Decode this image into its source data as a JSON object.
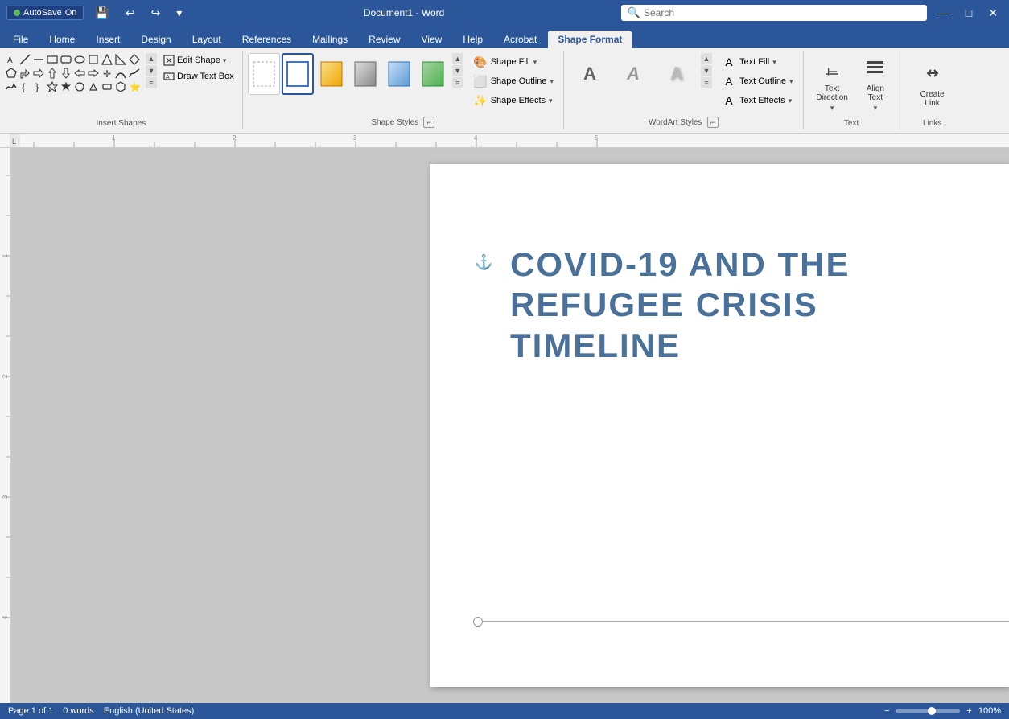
{
  "titlebar": {
    "autosave_label": "AutoSave",
    "autosave_on": "On",
    "save_icon": "💾",
    "undo_icon": "↩",
    "redo_icon": "↪",
    "customize_icon": "▾",
    "doc_title": "Document1 - Word",
    "search_placeholder": "Search",
    "search_icon": "🔍"
  },
  "ribbon_tabs": [
    {
      "label": "File",
      "active": false
    },
    {
      "label": "Home",
      "active": false
    },
    {
      "label": "Insert",
      "active": false
    },
    {
      "label": "Design",
      "active": false
    },
    {
      "label": "Layout",
      "active": false
    },
    {
      "label": "References",
      "active": false
    },
    {
      "label": "Mailings",
      "active": false
    },
    {
      "label": "Review",
      "active": false
    },
    {
      "label": "View",
      "active": false
    },
    {
      "label": "Help",
      "active": false
    },
    {
      "label": "Acrobat",
      "active": false
    },
    {
      "label": "Shape Format",
      "active": true
    }
  ],
  "groups": {
    "insert_shapes": {
      "label": "Insert Shapes",
      "edit_shape_label": "Edit Shape",
      "draw_text_box_label": "Draw Text Box"
    },
    "shape_styles": {
      "label": "Shape Styles",
      "swatches": [
        {
          "id": "none",
          "label": "No fill/border"
        },
        {
          "id": "blue-outline",
          "label": "Blue outline style",
          "selected": true
        },
        {
          "id": "s3",
          "label": "Style 3"
        },
        {
          "id": "s4",
          "label": "Style 4"
        },
        {
          "id": "s5",
          "label": "Style 5"
        },
        {
          "id": "s6",
          "label": "Style 6"
        }
      ],
      "fill_label": "Shape Fill",
      "outline_label": "Shape Outline",
      "effects_label": "Shape Effects",
      "format_shape_label": "Format Shape"
    },
    "wordart_styles": {
      "label": "WordArt Styles",
      "swatches": [
        {
          "id": "wa1",
          "char": "A",
          "style": "wordart-a1"
        },
        {
          "id": "wa2",
          "char": "A",
          "style": "wordart-a2"
        },
        {
          "id": "wa3",
          "char": "A",
          "style": "wordart-a3"
        }
      ],
      "text_fill_label": "Text Fill",
      "text_outline_label": "Text Outline",
      "text_effects_label": "Text Effects",
      "dialog_icon": "⌐"
    },
    "text": {
      "label": "Text",
      "text_direction_label": "Text\nDirection",
      "align_text_label": "Align\nText"
    },
    "links": {
      "label": "Links",
      "create_link_label": "Create\nLink"
    }
  },
  "document": {
    "title_line1": "COVID-19 AND THE",
    "title_line2": "REFUGEE CRISIS TIMELINE"
  },
  "statusbar": {
    "page_info": "Page 1 of 1",
    "word_count": "0 words",
    "language": "English (United States)",
    "zoom": "100%"
  },
  "style_swatches": [
    {
      "line_color": "transparent",
      "line_style": "dashed",
      "bg": "transparent"
    },
    {
      "line_color": "#5b9bd5",
      "bg": "#dce6f0"
    },
    {
      "line_color": "#f0a500",
      "bg": "transparent",
      "gradient": "linear-gradient(135deg, #f9e08b, #f0a500)"
    },
    {
      "line_color": "#888",
      "bg": "transparent",
      "gradient": "linear-gradient(135deg, #ccc, #888)"
    },
    {
      "line_color": "#5b9bd5",
      "bg": "transparent",
      "gradient": "linear-gradient(135deg, #c7ddf7, #5b9bd5)"
    },
    {
      "line_color": "#4caf50",
      "bg": "transparent",
      "gradient": "linear-gradient(135deg, #a8d5a2, #4caf50)"
    }
  ]
}
